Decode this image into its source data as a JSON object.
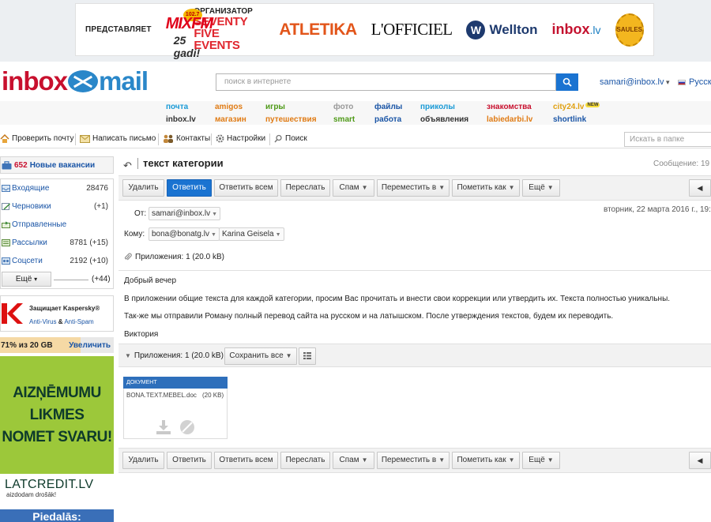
{
  "banner": {
    "presents": "ПРЕДСТАВЛЯЕТ",
    "mixfm": "MIXFM",
    "mixfm_freq": "102.7",
    "mixfm_sub": "25 gadi!",
    "organizer_label": "ОРГАНИЗАТОР",
    "organizer_name": "SEVENTY FIVE EVENTS",
    "atletika": "ATLETIKA",
    "lofficiel": "L'OFFICIEL",
    "wellton": "Wellton",
    "inbox": "inbox",
    "inbox_tld": ".lv",
    "saules": "SAULES"
  },
  "header": {
    "logo_part1": "inbox",
    "logo_part2": "mail",
    "search_placeholder": "поиск в интернете",
    "user_email": "samari@inbox.lv",
    "language": "Русск"
  },
  "nav": {
    "row1": [
      {
        "label": "почта",
        "color": "#1a9ad6"
      },
      {
        "label": "amigos",
        "color": "#e07b14"
      },
      {
        "label": "игры",
        "color": "#4f9a18"
      },
      {
        "label": "фото",
        "color": "#999999"
      },
      {
        "label": "файлы",
        "color": "#1a55a6"
      },
      {
        "label": "приколы",
        "color": "#1a9ad6"
      },
      {
        "label": "знакомства",
        "color": "#c8102e"
      },
      {
        "label": "city24.lv",
        "color": "#e0a010"
      }
    ],
    "row2": [
      {
        "label": "inbox.lv",
        "color": "#333333"
      },
      {
        "label": "магазин",
        "color": "#e07b14"
      },
      {
        "label": "путешествия",
        "color": "#e07b14"
      },
      {
        "label": "smart",
        "color": "#4f9a18"
      },
      {
        "label": "работа",
        "color": "#1a55a6"
      },
      {
        "label": "объявления",
        "color": "#333333"
      },
      {
        "label": "labiedarbi.lv",
        "color": "#e07b14"
      },
      {
        "label": "shortlink",
        "color": "#1a55a6"
      }
    ],
    "new_badge": "NEW"
  },
  "toolbar": {
    "check_mail": "Проверить почту",
    "compose": "Написать письмо",
    "contacts": "Контакты",
    "settings": "Настройки",
    "search": "Поиск",
    "folder_search_placeholder": "Искать в папке"
  },
  "sidebar": {
    "vacancies_count": "652",
    "vacancies_label": "Новые вакансии",
    "folders": [
      {
        "name": "Входящие",
        "count": "28476"
      },
      {
        "name": "Черновики",
        "count": "(+1)"
      },
      {
        "name": "Отправленные",
        "count": ""
      },
      {
        "name": "Рассылки",
        "count": "8781 (+15)"
      },
      {
        "name": "Соцсети",
        "count": "2192 (+10)"
      }
    ],
    "more_label": "Ещё",
    "more_count": "(+44)",
    "kaspersky_title": "Защищает Kaspersky®",
    "kaspersky_av": "Anti-Virus",
    "kaspersky_amp": "&",
    "kaspersky_as": "Anti-Spam",
    "quota_text": "71% из 20 GB",
    "quota_percent": 71,
    "quota_action": "Увеличить",
    "ad_lines": [
      "AIZŅĒMUMU",
      "LIKMES",
      "NOMET SVARU!"
    ],
    "ad_brand": "LATCREDIT.LV",
    "ad_brand_sub": "aizdodam drošāk!",
    "ad_blue_text": "Piedalās:"
  },
  "message": {
    "subject": "текст категории",
    "counter": "Сообщение: 19",
    "actions": {
      "delete": "Удалить",
      "reply": "Ответить",
      "reply_all": "Ответить всем",
      "forward": "Переслать",
      "spam": "Спам",
      "move": "Переместить в",
      "mark": "Пометить как",
      "more": "Ещё"
    },
    "from_label": "От:",
    "from": "samari@inbox.lv",
    "to_label": "Кому:",
    "to": [
      "bona@bonatg.lv",
      "Karina Geisela"
    ],
    "date": "вторник, 22 марта 2016 г., 19:3",
    "attachments_summary": "Приложения: 1 (20.0 kB)",
    "body": [
      "Добрый вечер",
      "В приложении общие текста для каждой категории, просим Вас прочитать и внести свои коррекции или утвердить их. Текста полностью уникальны.",
      "Так-же мы отправили Роману полный перевод сайта на русском и на латышском. После утверждения текстов, будем их переводить.",
      "Виктория"
    ],
    "save_all": "Сохранить все",
    "attachment": {
      "type": "ДОКУМЕНТ",
      "name": "BONA.TEXT.MEBEL.doc",
      "size": "(20 KB)"
    }
  }
}
